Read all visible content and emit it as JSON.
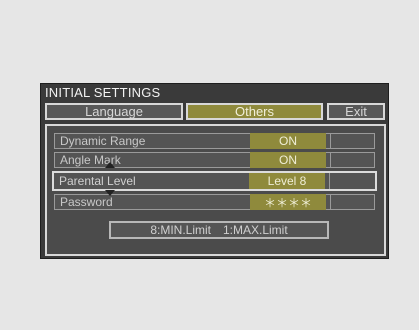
{
  "menu": {
    "title": "INITIAL  SETTINGS",
    "tabs": [
      {
        "label": "Language"
      },
      {
        "label": "Others"
      },
      {
        "label": "Exit"
      }
    ]
  },
  "settings": [
    {
      "label": "Dynamic Range",
      "value": "ON"
    },
    {
      "label": "Angle Mark",
      "value": "ON"
    },
    {
      "label": "Parental Level",
      "value": "Level 8"
    },
    {
      "label": "Password",
      "value": "＊＊＊＊"
    }
  ],
  "footer": {
    "min_limit": "8:MIN.Limit",
    "max_limit": "1:MAX.Limit"
  },
  "colors": {
    "highlight": "#8f8a3c",
    "background": "#3a3a3a",
    "page": "#e6e6e6"
  },
  "icons": [
    "up-arrow-icon",
    "down-arrow-icon"
  ]
}
